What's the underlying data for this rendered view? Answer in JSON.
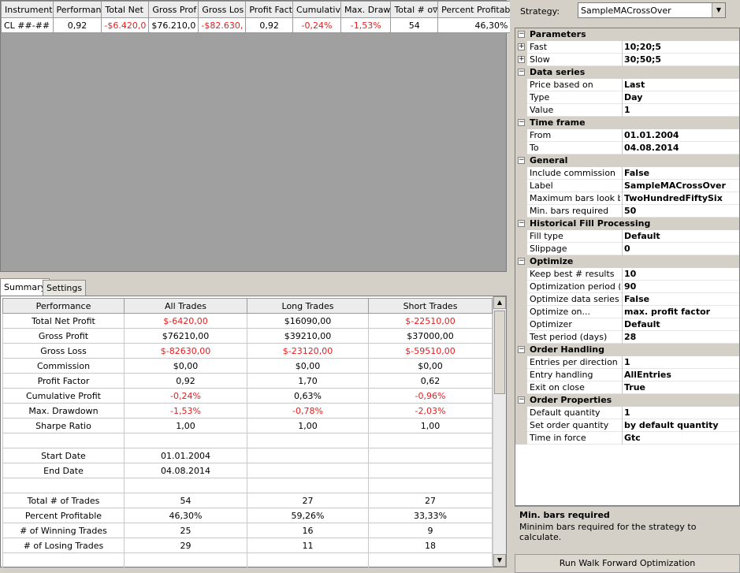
{
  "results_grid": {
    "columns": [
      "Instrument",
      "Performan",
      "Total Net",
      "Gross Prof",
      "Gross Los",
      "Profit Fact",
      "Cumulativ",
      "Max. Draw",
      "Total # o",
      "Percent Profitab"
    ],
    "sort_indicator": "∇",
    "row": [
      "CL ##-##",
      "0,92",
      "-$6.420,0",
      "$76.210,0",
      "-$82.630,",
      "0,92",
      "-0,24%",
      "-1,53%",
      "54",
      "46,30%"
    ]
  },
  "tabs": [
    "Summary",
    "Settings"
  ],
  "summary": {
    "headers": [
      "Performance",
      "All Trades",
      "Long Trades",
      "Short Trades"
    ],
    "rows": [
      [
        "Total Net Profit",
        "$-6420,00",
        "$16090,00",
        "$-22510,00"
      ],
      [
        "Gross Profit",
        "$76210,00",
        "$39210,00",
        "$37000,00"
      ],
      [
        "Gross Loss",
        "$-82630,00",
        "$-23120,00",
        "$-59510,00"
      ],
      [
        "Commission",
        "$0,00",
        "$0,00",
        "$0,00"
      ],
      [
        "Profit Factor",
        "0,92",
        "1,70",
        "0,62"
      ],
      [
        "Cumulative Profit",
        "-0,24%",
        "0,63%",
        "-0,96%"
      ],
      [
        "Max. Drawdown",
        "-1,53%",
        "-0,78%",
        "-2,03%"
      ],
      [
        "Sharpe Ratio",
        "1,00",
        "1,00",
        "1,00"
      ],
      [
        "",
        "",
        "",
        ""
      ],
      [
        "Start Date",
        "01.01.2004",
        "",
        ""
      ],
      [
        "End Date",
        "04.08.2014",
        "",
        ""
      ],
      [
        "",
        "",
        "",
        ""
      ],
      [
        "Total # of Trades",
        "54",
        "27",
        "27"
      ],
      [
        "Percent Profitable",
        "46,30%",
        "59,26%",
        "33,33%"
      ],
      [
        "# of Winning Trades",
        "25",
        "16",
        "9"
      ],
      [
        "# of Losing Trades",
        "29",
        "11",
        "18"
      ],
      [
        "",
        "",
        "",
        ""
      ]
    ]
  },
  "strategy": {
    "label": "Strategy:",
    "value": "SampleMACrossOver"
  },
  "properties": [
    {
      "type": "cat",
      "name": "Parameters"
    },
    {
      "type": "prop",
      "name": "Fast",
      "value": "10;20;5",
      "expand": true
    },
    {
      "type": "prop",
      "name": "Slow",
      "value": "30;50;5",
      "expand": true
    },
    {
      "type": "cat",
      "name": "Data series"
    },
    {
      "type": "prop",
      "name": "Price based on",
      "value": "Last"
    },
    {
      "type": "prop",
      "name": "Type",
      "value": "Day"
    },
    {
      "type": "prop",
      "name": "Value",
      "value": "1"
    },
    {
      "type": "cat",
      "name": "Time frame"
    },
    {
      "type": "prop",
      "name": "From",
      "value": "01.01.2004"
    },
    {
      "type": "prop",
      "name": "To",
      "value": "04.08.2014"
    },
    {
      "type": "cat",
      "name": "General"
    },
    {
      "type": "prop",
      "name": "Include commission",
      "value": "False"
    },
    {
      "type": "prop",
      "name": "Label",
      "value": "SampleMACrossOver"
    },
    {
      "type": "prop",
      "name": "Maximum bars look bac",
      "value": "TwoHundredFiftySix"
    },
    {
      "type": "prop",
      "name": "Min. bars required",
      "value": "50"
    },
    {
      "type": "cat",
      "name": "Historical Fill Processing"
    },
    {
      "type": "prop",
      "name": "Fill type",
      "value": "Default"
    },
    {
      "type": "prop",
      "name": "Slippage",
      "value": "0"
    },
    {
      "type": "cat",
      "name": "Optimize"
    },
    {
      "type": "prop",
      "name": "Keep best # results",
      "value": "10"
    },
    {
      "type": "prop",
      "name": "Optimization period (da",
      "value": "90"
    },
    {
      "type": "prop",
      "name": "Optimize data series",
      "value": "False"
    },
    {
      "type": "prop",
      "name": "Optimize on...",
      "value": "max. profit factor"
    },
    {
      "type": "prop",
      "name": "Optimizer",
      "value": "Default"
    },
    {
      "type": "prop",
      "name": "Test period (days)",
      "value": "28"
    },
    {
      "type": "cat",
      "name": "Order Handling"
    },
    {
      "type": "prop",
      "name": "Entries per direction",
      "value": "1"
    },
    {
      "type": "prop",
      "name": "Entry handling",
      "value": "AllEntries"
    },
    {
      "type": "prop",
      "name": "Exit on close",
      "value": "True"
    },
    {
      "type": "cat",
      "name": "Order Properties"
    },
    {
      "type": "prop",
      "name": "Default quantity",
      "value": "1"
    },
    {
      "type": "prop",
      "name": "Set order quantity",
      "value": "by default quantity"
    },
    {
      "type": "prop",
      "name": "Time in force",
      "value": "Gtc"
    }
  ],
  "help": {
    "title": "Min. bars required",
    "text": "Mininim bars required for the strategy to calculate."
  },
  "run_button": "Run Walk Forward Optimization",
  "colors": {
    "negative": "#e41e1e",
    "panel": "#d4d0c8",
    "grid_empty": "#a0a0a0"
  }
}
